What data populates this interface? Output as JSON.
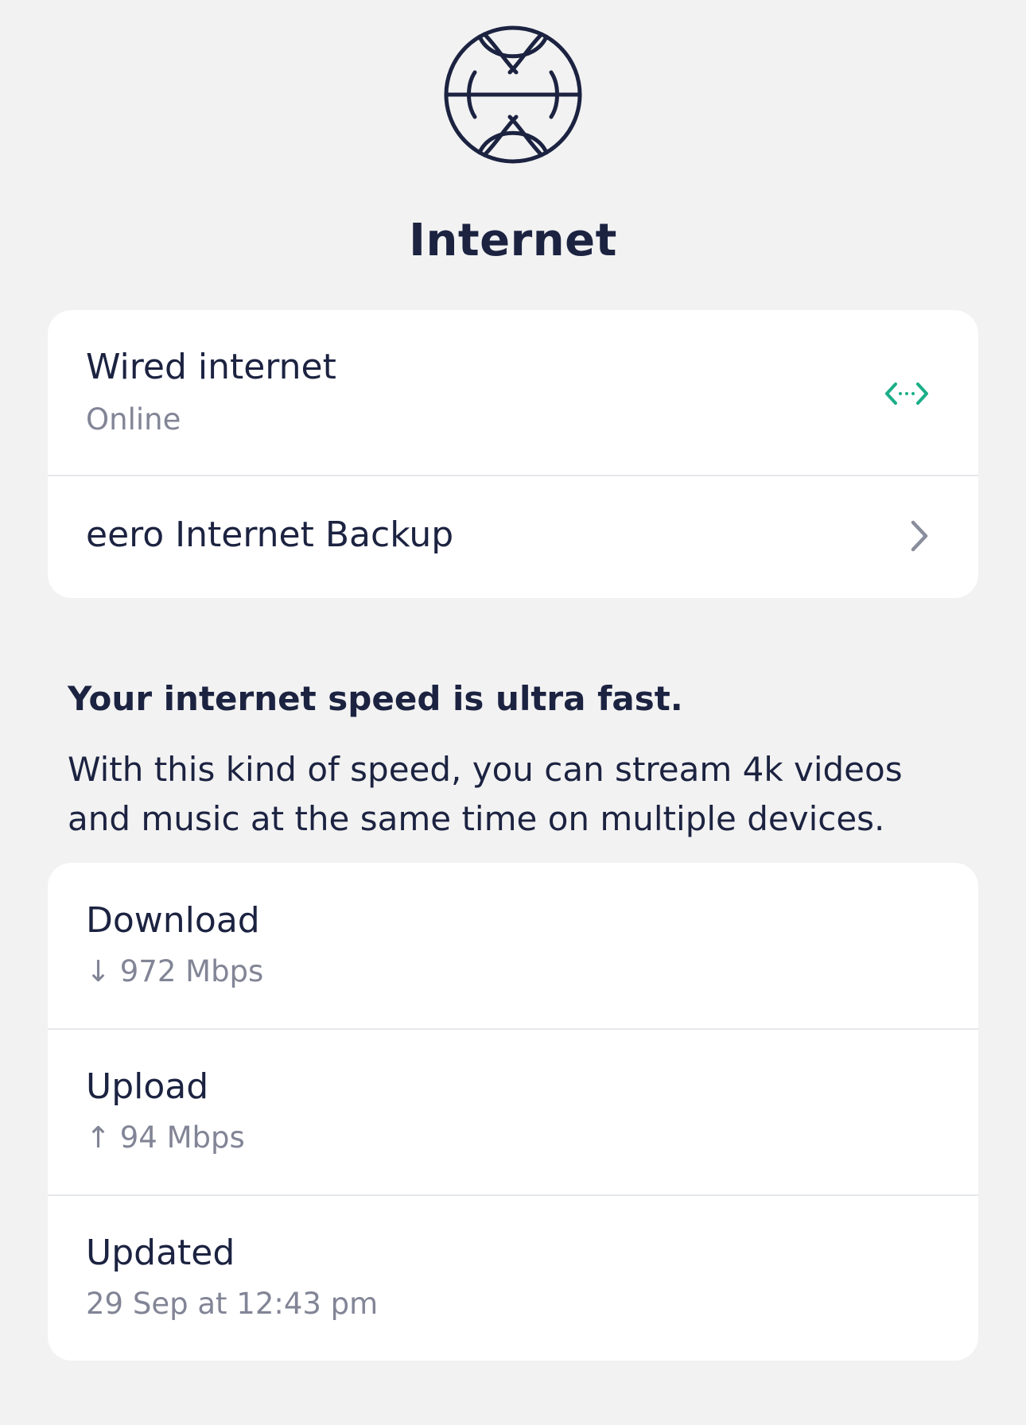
{
  "header": {
    "icon": "globe-icon",
    "title": "Internet"
  },
  "connection": {
    "wired": {
      "title": "Wired internet",
      "status": "Online",
      "status_icon": "connection-arrows-icon",
      "status_color": "#1bae88"
    },
    "backup": {
      "title": "eero Internet Backup",
      "accessory_icon": "chevron-right-icon"
    }
  },
  "speed_summary": {
    "heading": "Your internet speed is ultra fast.",
    "body": "With this kind of speed, you can stream 4k videos and music at the same time on multiple devices."
  },
  "speed": {
    "download": {
      "label": "Download",
      "value": "↓ 972 Mbps"
    },
    "upload": {
      "label": "Upload",
      "value": "↑ 94 Mbps"
    },
    "updated": {
      "label": "Updated",
      "value": "29 Sep at 12:43 pm"
    }
  },
  "colors": {
    "background": "#f2f2f2",
    "card": "#ffffff",
    "text_primary": "#1c2341",
    "text_secondary": "#828596",
    "accent_green": "#1bae88"
  }
}
